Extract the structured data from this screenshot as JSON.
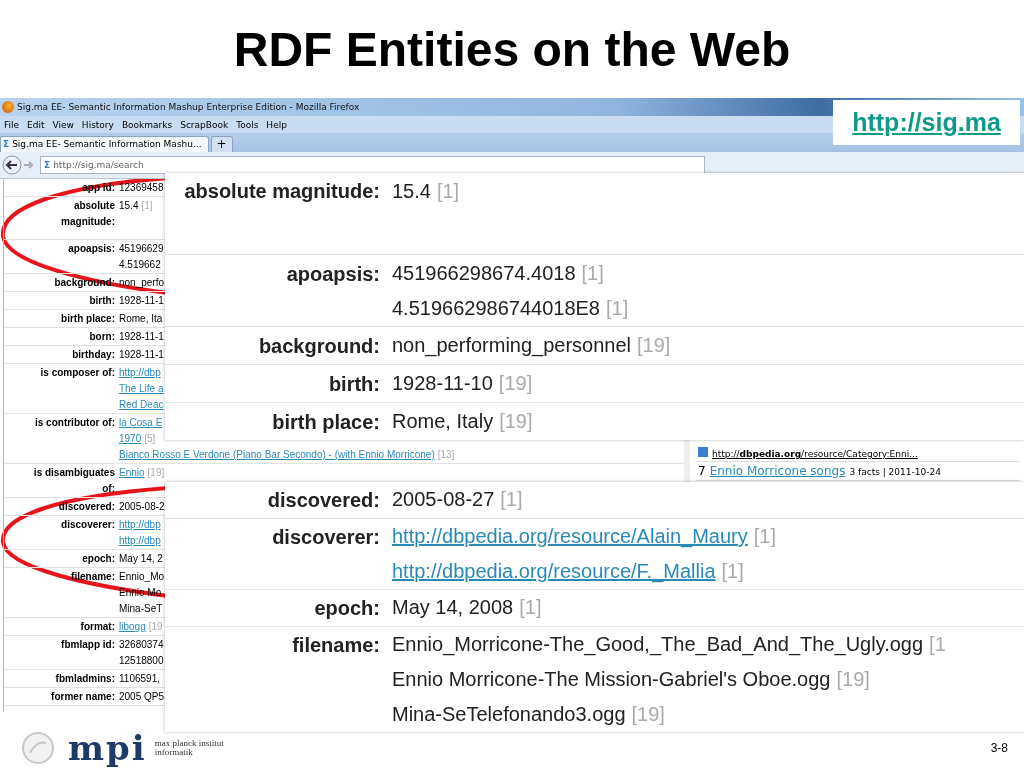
{
  "slide": {
    "title": "RDF Entities on the Web",
    "link": "http://sig.ma",
    "logo_mark": "mpi",
    "logo_lines": [
      "max planck institut",
      "informatik"
    ],
    "page_number": "3-8"
  },
  "browser": {
    "window_title": "Sig.ma EE- Semantic Information Mashup Enterprise Edition - Mozilla Firefox",
    "menu": [
      "File",
      "Edit",
      "View",
      "History",
      "Bookmarks",
      "ScrapBook",
      "Tools",
      "Help"
    ],
    "tab": {
      "icon": "Σ",
      "title": "Sig.ma EE- Semantic Information Mashu...",
      "selected": true
    },
    "new_tab": "+",
    "url_icon": "Σ",
    "url": "http://sig.ma/search"
  },
  "entity_rows": [
    {
      "label": "app id:",
      "values": [
        {
          "kind": "text",
          "text": "12369458"
        }
      ]
    },
    {
      "label": "absolute magnitude:",
      "values": [
        {
          "kind": "text",
          "text": "15.4",
          "count": "[1]"
        }
      ]
    },
    {
      "label": "apoapsis:",
      "values": [
        {
          "kind": "text",
          "text": "45196629"
        },
        {
          "kind": "text",
          "text": "4.519662"
        }
      ]
    },
    {
      "label": "background:",
      "values": [
        {
          "kind": "text",
          "text": "non_perfo"
        }
      ]
    },
    {
      "label": "birth:",
      "values": [
        {
          "kind": "text",
          "text": "1928-11-1"
        }
      ]
    },
    {
      "label": "birth place:",
      "values": [
        {
          "kind": "text",
          "text": "Rome, Ita"
        }
      ]
    },
    {
      "label": "born:",
      "values": [
        {
          "kind": "text",
          "text": "1928-11-1"
        }
      ]
    },
    {
      "label": "birthday:",
      "values": [
        {
          "kind": "text",
          "text": "1928-11-1"
        }
      ]
    },
    {
      "label": "is composer of:",
      "values": [
        {
          "kind": "link",
          "text": "http://dbp"
        },
        {
          "kind": "link",
          "text": "The Life a"
        },
        {
          "kind": "link",
          "text": "Red Deac"
        }
      ]
    },
    {
      "label": "is contributor of:",
      "values": [
        {
          "kind": "link",
          "text": "la Cosa E"
        },
        {
          "kind": "link",
          "text": "1970",
          "count": "[5]"
        },
        {
          "kind": "link",
          "text": "Bianco Rosso E Verdone (Piano Bar Secondo) - (with Ennio Morricone)",
          "count": "[13]"
        }
      ]
    },
    {
      "label": "is disambiguates of:",
      "values": [
        {
          "kind": "link",
          "text": "Ennio",
          "count": "[19]"
        }
      ]
    },
    {
      "label": "discovered:",
      "values": [
        {
          "kind": "text",
          "text": "2005-08-2"
        }
      ]
    },
    {
      "label": "discoverer:",
      "values": [
        {
          "kind": "link",
          "text": "http://dbp"
        },
        {
          "kind": "link",
          "text": "http://dbp"
        }
      ]
    },
    {
      "label": "epoch:",
      "values": [
        {
          "kind": "text",
          "text": "May 14, 2"
        }
      ]
    },
    {
      "label": "filename:",
      "values": [
        {
          "kind": "text",
          "text": "Ennio_Mo"
        },
        {
          "kind": "text",
          "text": "Ennio Mo"
        },
        {
          "kind": "text",
          "text": "Mina-SeT"
        }
      ]
    },
    {
      "label": "format:",
      "values": [
        {
          "kind": "link",
          "text": "libogg",
          "count": "[19"
        }
      ]
    },
    {
      "label": "fbmlapp id:",
      "values": [
        {
          "kind": "text",
          "text": "32680374"
        },
        {
          "kind": "text",
          "text": "12518800"
        }
      ]
    },
    {
      "label": "fbmladmins:",
      "values": [
        {
          "kind": "text",
          "text": "1106591,"
        }
      ]
    },
    {
      "label": "former name:",
      "values": [
        {
          "kind": "text",
          "text": "2005 QP5"
        }
      ]
    }
  ],
  "side_items": [
    {
      "kind": "source",
      "link": "http://**dbpedia.org**/resource/Category:Enni..."
    },
    {
      "kind": "result",
      "number": "7",
      "link": "Ennio Morricone songs",
      "meta": "3 facts | 2011-10-24"
    }
  ],
  "callouts": [
    {
      "rows": [
        {
          "label": "absolute magnitude:",
          "values": [
            {
              "kind": "text",
              "text": "15.4",
              "count": "[1]"
            }
          ]
        },
        {
          "label": "apoapsis:",
          "values": [
            {
              "kind": "text",
              "text": "451966298674.4018",
              "count": "[1]"
            },
            {
              "kind": "text",
              "text": "4.519662986744018E8",
              "count": "[1]"
            }
          ]
        },
        {
          "label": "background:",
          "values": [
            {
              "kind": "text",
              "text": "non_performing_personnel",
              "count": "[19]"
            }
          ]
        },
        {
          "label": "birth:",
          "values": [
            {
              "kind": "text",
              "text": "1928-11-10",
              "count": "[19]"
            }
          ]
        },
        {
          "label": "birth place:",
          "values": [
            {
              "kind": "text",
              "text": "Rome, Italy",
              "count": "[19]"
            }
          ]
        }
      ]
    },
    {
      "rows": [
        {
          "label": "discovered:",
          "values": [
            {
              "kind": "text",
              "text": "2005-08-27",
              "count": "[1]"
            }
          ]
        },
        {
          "label": "discoverer:",
          "values": [
            {
              "kind": "link",
              "text": "http://dbpedia.org/resource/Alain_Maury",
              "count": "[1]"
            },
            {
              "kind": "link",
              "text": "http://dbpedia.org/resource/F._Mallia",
              "count": "[1]"
            }
          ]
        },
        {
          "label": "epoch:",
          "values": [
            {
              "kind": "text",
              "text": "May 14, 2008",
              "count": "[1]"
            }
          ]
        },
        {
          "label": "filename:",
          "values": [
            {
              "kind": "text",
              "text": "Ennio_Morricone-The_Good,_The_Bad_And_The_Ugly.ogg",
              "count": "[1"
            },
            {
              "kind": "text",
              "text": "Ennio Morricone-The Mission-Gabriel's Oboe.ogg",
              "count": "[19]"
            },
            {
              "kind": "text",
              "text": "Mina-SeTelefonando3.ogg",
              "count": "[19]"
            }
          ]
        }
      ]
    }
  ]
}
